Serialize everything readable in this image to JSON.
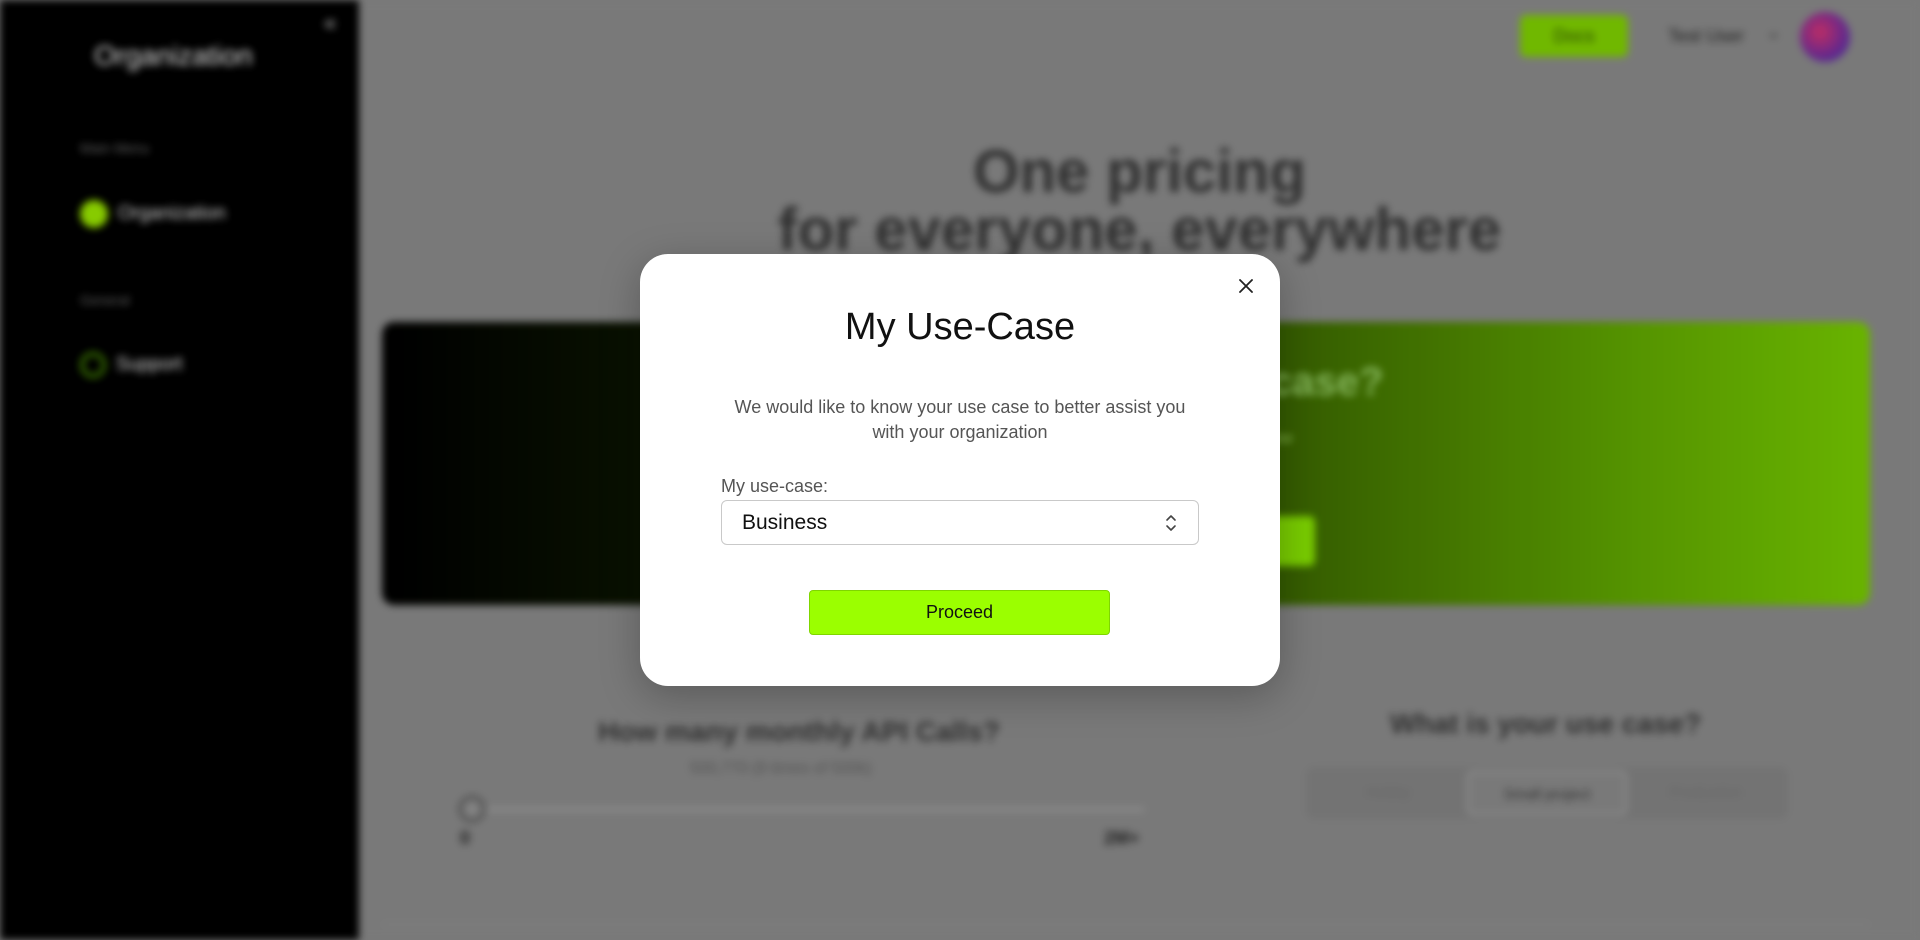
{
  "sidebar": {
    "title": "Organization",
    "section_main": "Main Menu",
    "item_organization": "Organization",
    "section_general": "General",
    "item_support": "Support"
  },
  "topbar": {
    "primary_button": "Docs",
    "user_name": "Test User"
  },
  "hero": {
    "line1": "One pricing",
    "line2": "for everyone, everywhere"
  },
  "banner": {
    "question": "case?",
    "subtitle": "ew"
  },
  "api_calls": {
    "title": "How many monthly API Calls?",
    "subtitle": "500,770 (8 times of 500k)",
    "min_label": "0",
    "max_label": "2M+",
    "level": 0
  },
  "use_case_section": {
    "title": "What is your use case?",
    "options": [
      "Hobby",
      "Small project",
      "Production"
    ],
    "selected": "Small project"
  },
  "modal": {
    "title": "My Use-Case",
    "description": "We would like to know your use case to better assist you with your organization",
    "field_label": "My use-case:",
    "select_value": "Business",
    "proceed_label": "Proceed"
  },
  "colors": {
    "accent": "#9bff00",
    "sidebar_bg": "#000000",
    "modal_bg": "#ffffff"
  }
}
